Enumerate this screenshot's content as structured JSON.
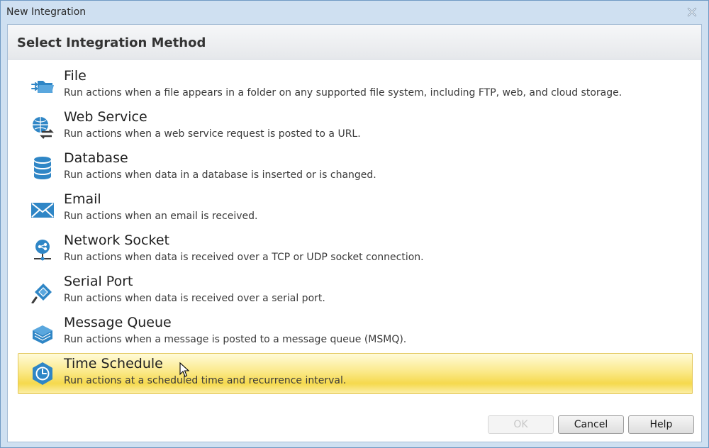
{
  "window": {
    "title": "New Integration"
  },
  "panel": {
    "title": "Select Integration Method"
  },
  "options": [
    {
      "name": "File",
      "description": "Run actions when a file appears in a folder on any supported file system, including FTP, web, and cloud storage.",
      "icon": "folder-icon"
    },
    {
      "name": "Web Service",
      "description": "Run actions when a web service request is posted to a URL.",
      "icon": "globe-arrows-icon"
    },
    {
      "name": "Database",
      "description": "Run actions when data in a database is inserted or is changed.",
      "icon": "database-icon"
    },
    {
      "name": "Email",
      "description": "Run actions when an email is received.",
      "icon": "envelope-icon"
    },
    {
      "name": "Network Socket",
      "description": "Run actions when data is received over a TCP or UDP socket connection.",
      "icon": "network-socket-icon"
    },
    {
      "name": "Serial Port",
      "description": "Run actions when data is received over a serial port.",
      "icon": "serial-port-icon"
    },
    {
      "name": "Message Queue",
      "description": "Run actions when a message is posted to a message queue (MSMQ).",
      "icon": "message-queue-icon"
    },
    {
      "name": "Time Schedule",
      "description": "Run actions at a scheduled time and recurrence interval.",
      "icon": "clock-icon",
      "selected": true
    }
  ],
  "buttons": {
    "ok": "OK",
    "cancel": "Cancel",
    "help": "Help"
  },
  "colors": {
    "icon_blue": "#2f86c6",
    "selection": "#fbe98a",
    "window_frame": "#cfe0f1"
  }
}
